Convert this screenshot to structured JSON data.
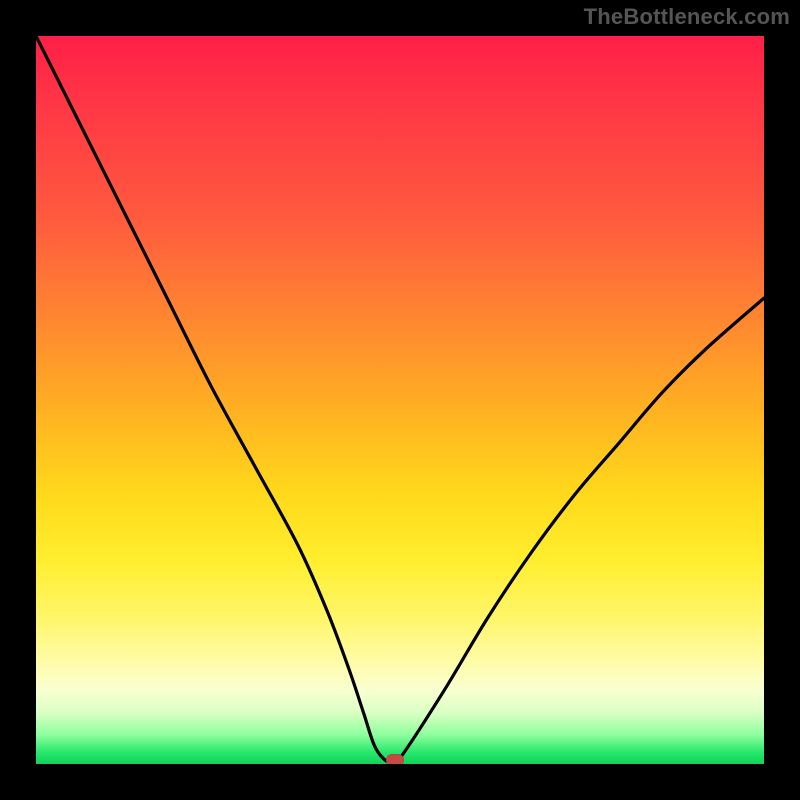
{
  "attribution": "TheBottleneck.com",
  "chart_data": {
    "type": "line",
    "title": "",
    "xlabel": "",
    "ylabel": "",
    "xlim": [
      0,
      100
    ],
    "ylim": [
      0,
      100
    ],
    "x": [
      0,
      6,
      12,
      18,
      24,
      30,
      36,
      40,
      43,
      45,
      46.5,
      48,
      49,
      50,
      56,
      62,
      68,
      74,
      80,
      86,
      92,
      100
    ],
    "y": [
      100,
      88,
      76,
      64,
      52,
      41,
      30,
      21,
      13,
      7,
      2.5,
      0.5,
      0.5,
      0.8,
      10,
      20,
      29,
      37,
      44,
      51,
      57,
      64
    ],
    "marker": {
      "x": 49.3,
      "y": 0.6
    },
    "background_gradient": {
      "top": "#ff1f47",
      "mid_upper": "#ff8a2f",
      "mid": "#ffee2e",
      "mid_lower": "#f8ffd1",
      "bottom": "#11d35b"
    }
  }
}
